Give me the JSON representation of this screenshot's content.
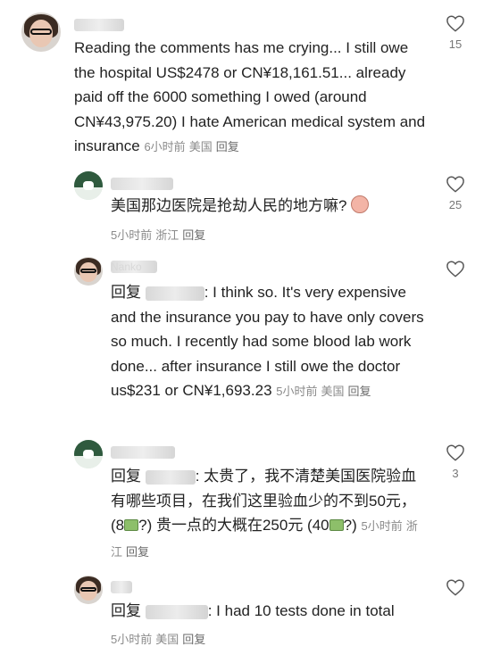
{
  "comments": [
    {
      "username": "user",
      "text": "Reading the comments has me crying... I still owe the hospital US$2478 or CN¥18,161.51... already paid off the 6000 something I owed (around CN¥43,975.20)  I hate American medical system and insurance",
      "time": "6小时前",
      "location": "美国",
      "reply": "回复",
      "likes": "15"
    },
    {
      "username": "user",
      "text": "美国那边医院是抢劫人民的地方嘛?",
      "time": "5小时前",
      "location": "浙江",
      "reply": "回复",
      "likes": "25"
    },
    {
      "username": "Nanko",
      "reply_prefix": "回复",
      "mention": "user",
      "text": ": I think so. It's very expensive and the insurance you pay to have only covers so much. I recently had some blood lab work done... after insurance I still owe the doctor us$231 or CN¥1,693.23",
      "time": "5小时前",
      "location": "美国",
      "reply": "回复",
      "likes": ""
    },
    {
      "username": "user",
      "reply_prefix": "回复",
      "mention": "user",
      "text_a": ": 太贵了，我不清楚美国医院验血有哪些项目，在我们这里验血少的不到50元，(8",
      "text_b": "?) 贵一点的大概在250元 (40",
      "text_c": "?)",
      "time": "5小时前",
      "location": "浙江",
      "reply": "回复",
      "likes": "3"
    },
    {
      "username": "user",
      "reply_prefix": "回复",
      "mention": "user",
      "text": ": I had 10 tests done in total",
      "time": "5小时前",
      "location": "美国",
      "reply": "回复",
      "likes": ""
    }
  ],
  "icons": {
    "like": "heart-outline-icon",
    "money": "money-bag-emoji-icon",
    "face": "pig-face-emoji-icon"
  },
  "colors": {
    "meta": "#8a8a8a",
    "text": "#222222"
  }
}
